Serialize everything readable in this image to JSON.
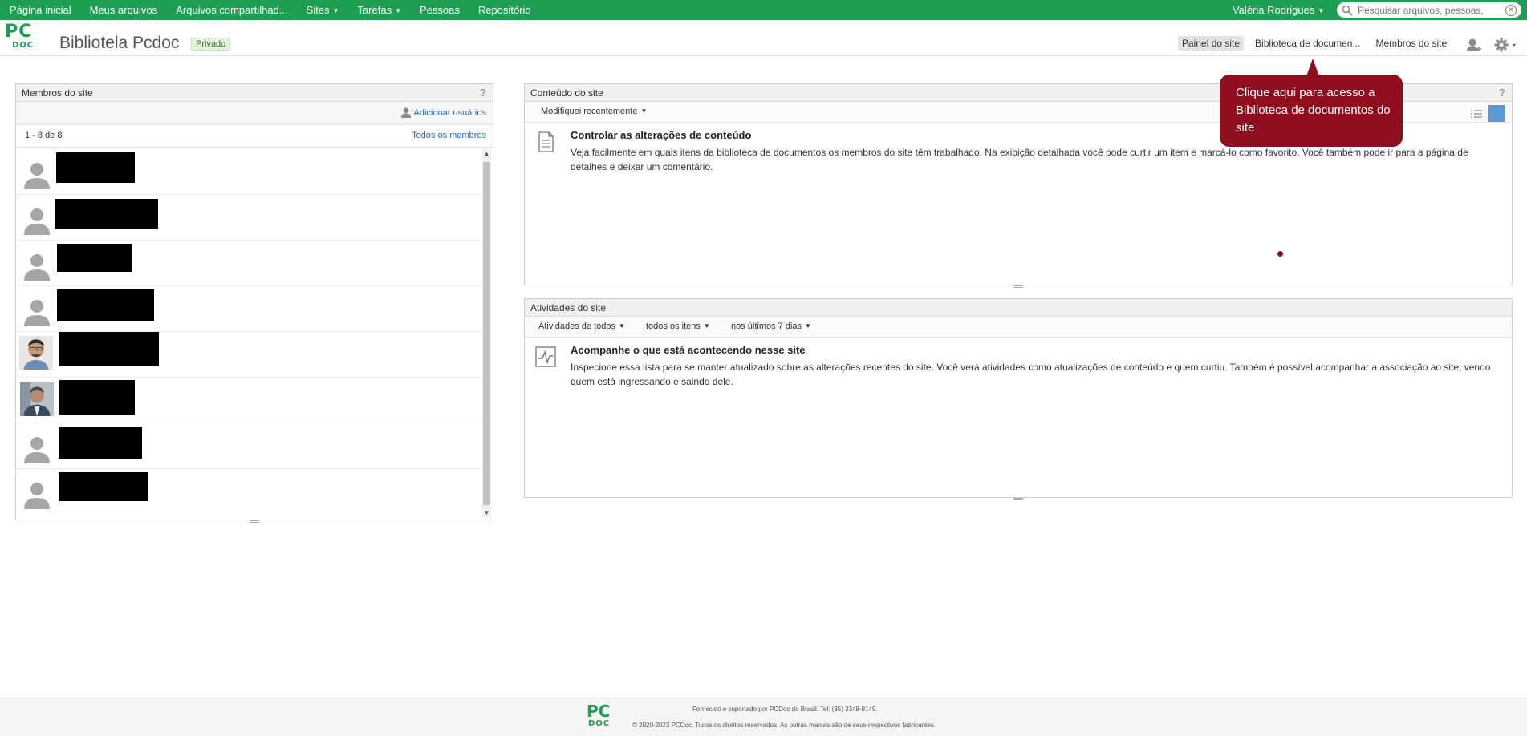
{
  "topnav": {
    "items": [
      {
        "label": "Página inicial",
        "dropdown": false
      },
      {
        "label": "Meus arquivos",
        "dropdown": false
      },
      {
        "label": "Arquivos compartilhad...",
        "dropdown": false
      },
      {
        "label": "Sites",
        "dropdown": true
      },
      {
        "label": "Tarefas",
        "dropdown": true
      },
      {
        "label": "Pessoas",
        "dropdown": false
      },
      {
        "label": "Repositório",
        "dropdown": false
      }
    ],
    "user_name": "Valéria Rodrigues",
    "search_placeholder": "Pesquisar arquivos, pessoas, s",
    "accent_color": "#1e9e53"
  },
  "site": {
    "logo_top": "PC",
    "logo_bottom": "DOC",
    "title": "Bibliotela Pcdoc",
    "privacy": "Privado",
    "nav": [
      {
        "label": "Painel do site",
        "active": true
      },
      {
        "label": "Biblioteca de documen...",
        "active": false
      },
      {
        "label": "Membros do site",
        "active": false
      }
    ]
  },
  "members_dashlet": {
    "title": "Membros do site",
    "help": "?",
    "add_users": "Adicionar usuários",
    "count": "1 - 8 de 8",
    "all_members": "Todos os membros",
    "members": [
      {
        "avatar": "default"
      },
      {
        "avatar": "default"
      },
      {
        "avatar": "default"
      },
      {
        "avatar": "default"
      },
      {
        "avatar": "photo"
      },
      {
        "avatar": "photo"
      },
      {
        "avatar": "default"
      },
      {
        "avatar": "default"
      }
    ]
  },
  "content_dashlet": {
    "title": "Conteúdo do site",
    "help": "?",
    "filter": "Modifiquei recentemente",
    "info_title": "Controlar as alterações de conteúdo",
    "info_text": "Veja facilmente em quais itens da biblioteca de documentos os membros do site têm trabalhado. Na exibição detalhada você pode curtir um item e marcá-lo como favorito. Você também pode ir para a página de detalhes e deixar um comentário."
  },
  "activities_dashlet": {
    "title": "Atividades do site",
    "filters": [
      "Atividades de todos",
      "todos os itens",
      "nos últimos 7 dias"
    ],
    "info_title": "Acompanhe o que está acontecendo nesse site",
    "info_text": "Inspecione essa lista para se manter atualizado sobre as alterações recentes do site. Você verá atividades como atualizações de conteúdo e quem curtiu. Também é possível acompanhar a associação ao site, vendo quem está ingressando e saindo dele."
  },
  "callout": {
    "text": "Clique aqui para acesso a Biblioteca de documentos do site",
    "color": "#8e0d1f"
  },
  "footer": {
    "line1": "Fornecido e suportado por PCDoc do Brasil. Tel: (85) 3348-8149.",
    "line2": "© 2020-2023 PCDoc. Todos os direitos reservados. As outras marcas são de seus respectivos fabricantes."
  }
}
